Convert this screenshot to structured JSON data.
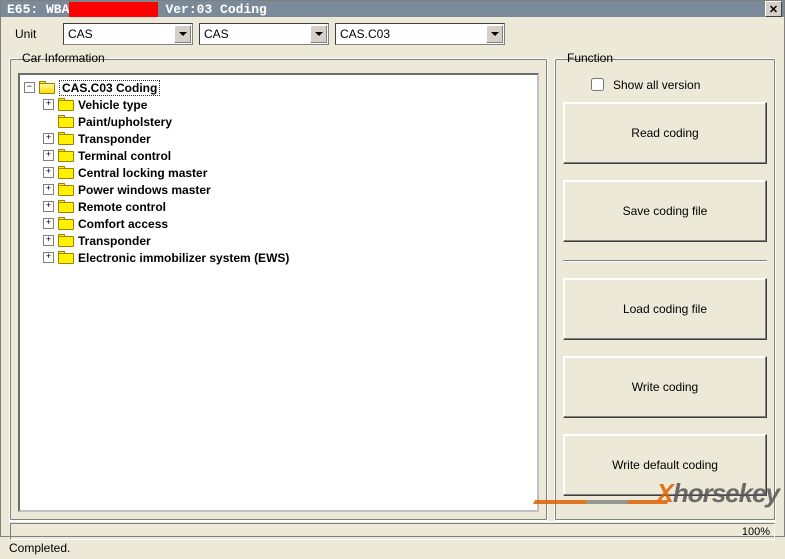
{
  "title": {
    "prefix": "E65: WBA",
    "redacted": "█████████",
    "suffix": " Ver:03 Coding"
  },
  "unit_label": "Unit",
  "combos": [
    {
      "value": "CAS"
    },
    {
      "value": "CAS"
    },
    {
      "value": "CAS.C03"
    }
  ],
  "car_info_legend": "Car Information",
  "tree": {
    "root": {
      "label": "CAS.C03 Coding",
      "state": "expanded"
    },
    "children": [
      {
        "label": "Vehicle type",
        "expandable": true
      },
      {
        "label": "Paint/upholstery",
        "expandable": false
      },
      {
        "label": "Transponder",
        "expandable": true
      },
      {
        "label": "Terminal control",
        "expandable": true
      },
      {
        "label": "Central locking master",
        "expandable": true
      },
      {
        "label": "Power windows master",
        "expandable": true
      },
      {
        "label": "Remote control",
        "expandable": true
      },
      {
        "label": "Comfort access",
        "expandable": true
      },
      {
        "label": "Transponder",
        "expandable": true
      },
      {
        "label": "Electronic immobilizer system (EWS)",
        "expandable": true
      }
    ]
  },
  "function": {
    "legend": "Function",
    "show_all_label": "Show all version",
    "buttons": [
      "Read coding",
      "Save coding file",
      "Load coding file",
      "Write coding",
      "Write default coding"
    ]
  },
  "status": {
    "progress_text": "100%",
    "completed_text": "Completed."
  },
  "watermark": {
    "x": "X",
    "rest": "horsekey"
  }
}
